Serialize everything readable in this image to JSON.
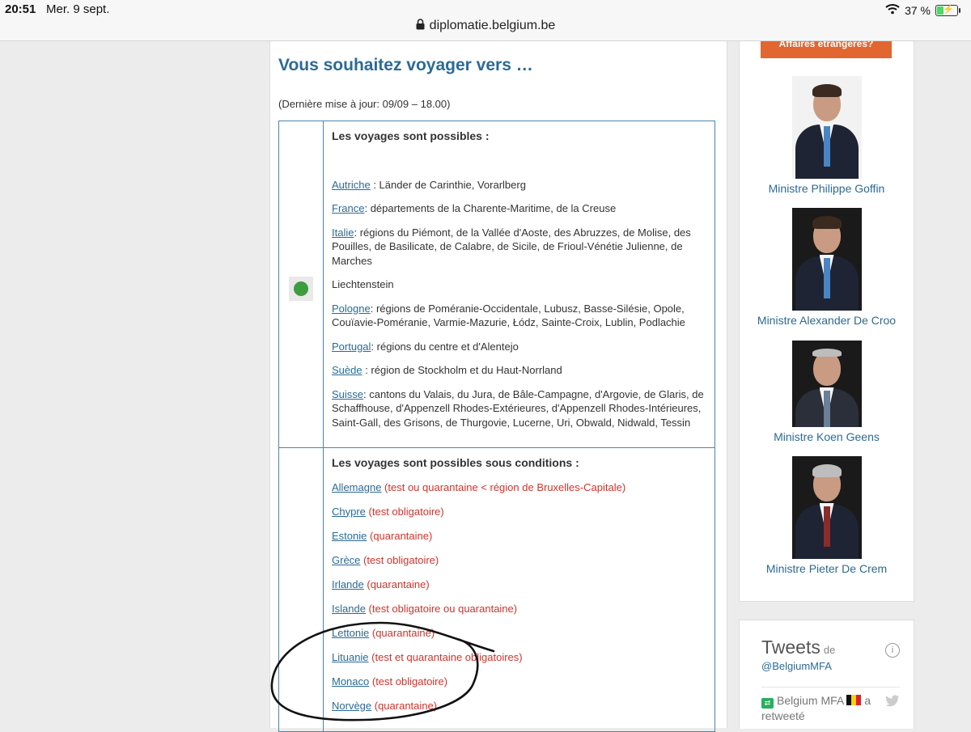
{
  "status_bar": {
    "time": "20:51",
    "date": "Mer. 9 sept.",
    "url": "diplomatie.belgium.be",
    "battery": "37 %",
    "battery_level": 0.37
  },
  "page": {
    "title": "Vous souhaitez voyager vers …",
    "update_note": "(Dernière mise à jour: 09/09 – 18.00)"
  },
  "sections": {
    "possible": {
      "heading": "Les voyages sont possibles :",
      "status_color": "#3e9d3e",
      "entries": [
        {
          "country": "Autriche",
          "detail": " : Länder de Carinthie, Vorarlberg"
        },
        {
          "country": "France",
          "detail": ": départements de la Charente-Maritime, de la Creuse"
        },
        {
          "country": "Italie",
          "detail": ": régions du Piémont, de la Vallée d'Aoste, des Abruzzes, de Molise, des Pouilles, de Basilicate, de Calabre, de Sicile, de Frioul-Vénétie Julienne, de Marches"
        },
        {
          "plain": "Liechtenstein"
        },
        {
          "country": "Pologne",
          "detail": ": régions de Poméranie-Occidentale, Lubusz, Basse-Silésie, Opole, Couïavie-Poméranie, Varmie-Mazurie, Łódz, Sainte-Croix, Lublin, Podlachie"
        },
        {
          "country": "Portugal",
          "detail": ": régions du centre et d'Alentejo"
        },
        {
          "country": "Suède",
          "detail": " : région de Stockholm et du Haut-Norrland"
        },
        {
          "country": "Suisse",
          "detail": ": cantons du Valais, du Jura, de Bâle-Campagne, d'Argovie, de Glaris, de Schaffhouse, d'Appenzell Rhodes-Extérieures,  d'Appenzell Rhodes-Intérieures, Saint-Gall, des Grisons, de Thurgovie, Lucerne, Uri, Obwald, Nidwald, Tessin"
        }
      ]
    },
    "conditional": {
      "heading": "Les voyages sont possibles sous conditions :",
      "entries": [
        {
          "country": "Allemagne",
          "condition": " (test ou quarantaine < région de Bruxelles-Capitale)"
        },
        {
          "country": "Chypre",
          "condition": " (test obligatoire)"
        },
        {
          "country": "Estonie",
          "condition": " (quarantaine)"
        },
        {
          "country": "Grèce",
          "condition": " (test obligatoire)"
        },
        {
          "country": "Irlande",
          "condition": " (quarantaine)"
        },
        {
          "country": "Islande",
          "condition": " (test obligatoire ou quarantaine)"
        },
        {
          "country": "Lettonie",
          "condition": " (quarantaine)"
        },
        {
          "country": "Lituanie",
          "condition": " (test et quarantaine obligatoires)"
        },
        {
          "country": "Monaco",
          "condition": " (test obligatoire)"
        },
        {
          "country": "Norvège",
          "condition": " (quarantaine)"
        }
      ]
    }
  },
  "sidebar": {
    "button_label": "Affaires etrangeres?",
    "ministers": [
      {
        "name": "Ministre Philippe Goffin"
      },
      {
        "name": "Ministre Alexander De Croo"
      },
      {
        "name": "Ministre Koen Geens"
      },
      {
        "name": "Ministre Pieter De Crem"
      }
    ]
  },
  "tweets": {
    "title": "Tweets",
    "de": "de",
    "handle": "@BelgiumMFA",
    "account": "Belgium MFA",
    "a": "a",
    "retweeted": "retweeté"
  }
}
